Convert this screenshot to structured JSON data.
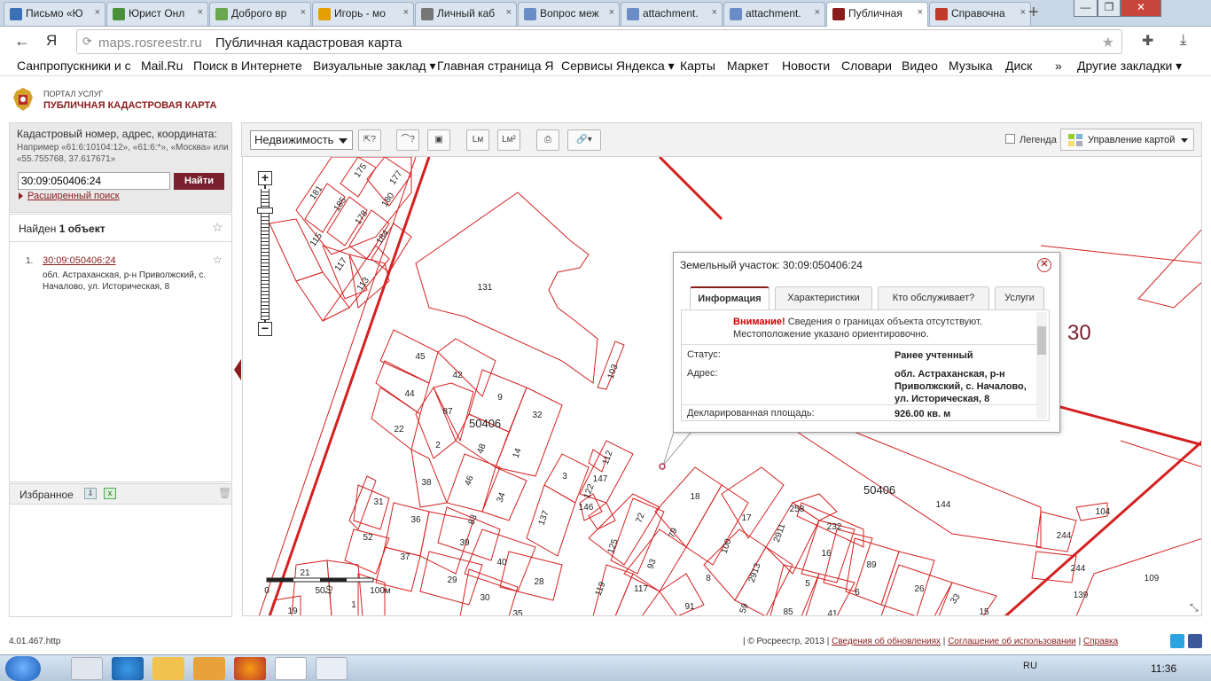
{
  "browser": {
    "tabs": [
      {
        "label": "Письмо «Ю",
        "icon_color": "#3b6fb6",
        "icon": "mail-icon"
      },
      {
        "label": "Юрист Онл",
        "icon_color": "#4a8f3a",
        "icon": "scales-icon"
      },
      {
        "label": "Доброго вр",
        "icon_color": "#6aa84f",
        "icon": "e-icon"
      },
      {
        "label": "Игорь - мо",
        "icon_color": "#e5a000",
        "icon": "folder-icon"
      },
      {
        "label": "Личный каб",
        "icon_color": "#777777",
        "icon": "section-icon"
      },
      {
        "label": "Вопрос меж",
        "icon_color": "#6a8dc8",
        "icon": "doc-icon"
      },
      {
        "label": "attachment.",
        "icon_color": "#6a8dc8",
        "icon": "doc-icon"
      },
      {
        "label": "attachment.",
        "icon_color": "#6a8dc8",
        "icon": "doc-icon"
      },
      {
        "label": "Публичная",
        "icon_color": "#8a1c1c",
        "icon": "globe-icon",
        "active": true
      },
      {
        "label": "Справочна",
        "icon_color": "#c0392b",
        "icon": "emblem-icon"
      }
    ],
    "url_host": "maps.rosreestr.ru",
    "page_title": "Публичная кадастровая карта",
    "yandex_mark": "Я",
    "bookmarks": [
      "Санпропускники и с",
      "Mail.Ru",
      "Поиск в Интернете",
      "Визуальные заклад ▾",
      "Главная страница Я",
      "Сервисы Яндекса ▾",
      "Карты",
      "Маркет",
      "Новости",
      "Словари",
      "Видео",
      "Музыка",
      "Диск",
      "»",
      "Другие закладки ▾"
    ]
  },
  "portal": {
    "subtitle": "ПОРТАЛ УСЛУГ",
    "title": "ПУБЛИЧНАЯ КАДАСТРОВАЯ КАРТА"
  },
  "search": {
    "label": "Кадастровый номер, адрес, координата:",
    "hint": "Например «61:6:10104:12», «61:6:*», «Москва» или «55.755768, 37.617671»",
    "value": "30:09:050406:24",
    "button": "Найти",
    "advanced": "Расширенный поиск"
  },
  "results": {
    "found_prefix": "Найден",
    "found_count": "1 объект",
    "items": [
      {
        "num": "1.",
        "id": "30:09:050406:24",
        "address": "обл. Астраханская, р-н Приволжский, с. Началово, ул. Историческая, 8"
      }
    ]
  },
  "favorites": {
    "label": "Избранное"
  },
  "toolbar": {
    "layer": "Недвижимость",
    "legend": "Легенда",
    "map_control": "Управление картой"
  },
  "map": {
    "scale_labels": [
      "0",
      "50",
      "100м"
    ],
    "big_label": "30",
    "block_labels": [
      "50406",
      "50406"
    ]
  },
  "popup": {
    "title": "Земельный участок: 30:09:050406:24",
    "tabs": [
      "Информация",
      "Характеристики",
      "Кто обслуживает?",
      "Услуги"
    ],
    "warning_strong": "Внимание!",
    "warning_text": " Сведения о границах объекта отсутствуют. Местоположение указано ориентировочно.",
    "rows": [
      {
        "label": "Статус:",
        "value": "Ранее учтенный"
      },
      {
        "label": "Адрес:",
        "value": "обл. Астраханская, р-н Приволжский, с. Началово, ул. Историческая, 8"
      },
      {
        "label": "Декларированная площадь:",
        "value": "926.00 кв. м"
      }
    ]
  },
  "footer": {
    "version": "4.01.467.http",
    "copyright": "| © Росреестр, 2013 |",
    "links": [
      "Сведения об обновлениях",
      "Соглашение об использовании",
      "Справка"
    ],
    "seps": [
      "|",
      "|"
    ]
  },
  "taskbar": {
    "lang": "RU",
    "clock": "11:36"
  },
  "colors": {
    "accent": "#8a1c1c",
    "parcel": "#d42020"
  }
}
